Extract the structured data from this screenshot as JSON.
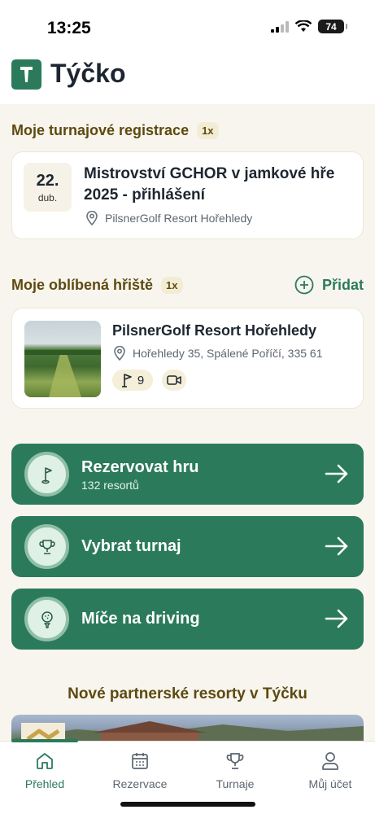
{
  "status_bar": {
    "time": "13:25",
    "battery": "74"
  },
  "app": {
    "title": "Týčko"
  },
  "registrations": {
    "heading": "Moje turnajové registrace",
    "count": "1x",
    "items": [
      {
        "day": "22.",
        "month": "dub.",
        "title": "Mistrovství GCHOR v jamkové hře 2025 - přihlášení",
        "location": "PilsnerGolf Resort Hořehledy"
      }
    ]
  },
  "favorites": {
    "heading": "Moje oblíbená hřiště",
    "count": "1x",
    "add_label": "Přidat",
    "items": [
      {
        "name": "PilsnerGolf Resort Hořehledy",
        "address": "Hořehledy 35, Spálené Poříčí, 335 61",
        "holes": "9"
      }
    ]
  },
  "actions": [
    {
      "title": "Rezervovat hru",
      "subtitle": "132 resortů",
      "icon": "flag-icon"
    },
    {
      "title": "Vybrat turnaj",
      "icon": "trophy-icon"
    },
    {
      "title": "Míče na driving",
      "icon": "golf-ball-icon"
    }
  ],
  "partners": {
    "heading": "Nové partnerské resorty v Týčku"
  },
  "tabs": [
    {
      "label": "Přehled",
      "icon": "home-icon",
      "active": true
    },
    {
      "label": "Rezervace",
      "icon": "calendar-icon",
      "active": false
    },
    {
      "label": "Turnaje",
      "icon": "trophy-icon",
      "active": false
    },
    {
      "label": "Můj účet",
      "icon": "user-icon",
      "active": false
    }
  ],
  "colors": {
    "accent": "#2b7a5c",
    "section_heading": "#5d4a10",
    "background": "#f8f5ee"
  }
}
